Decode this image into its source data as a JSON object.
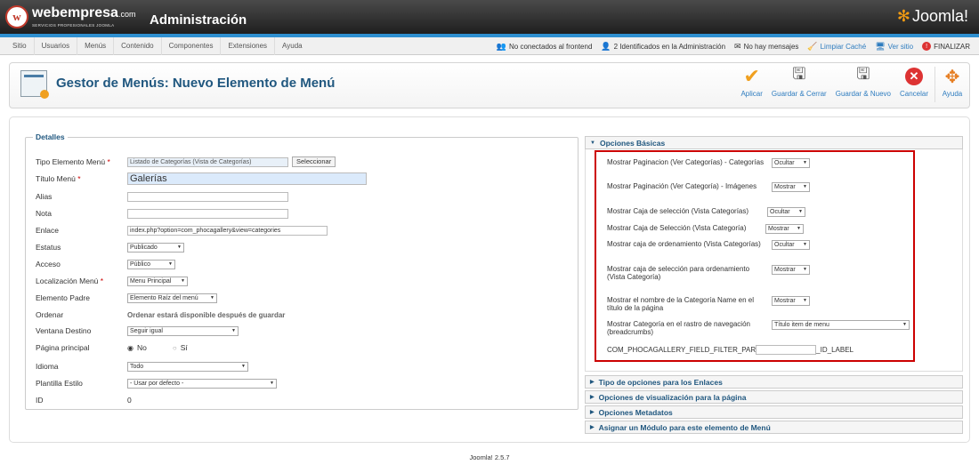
{
  "header": {
    "brand": "webempresa",
    "brand_suffix": ".com",
    "brand_tagline": "SERVICIOS PROFESIONALES JOOMLA",
    "title": "Administración",
    "joomla_logo": "Joomla!"
  },
  "nav": {
    "items": [
      "Sitio",
      "Usuarios",
      "Menús",
      "Contenido",
      "Componentes",
      "Extensiones",
      "Ayuda"
    ]
  },
  "status": {
    "frontend": "No conectados al frontend",
    "admins": "2 Identificados en la Administración",
    "messages": "No hay mensajes",
    "clear_cache": "Limpiar Caché",
    "view_site": "Ver sitio",
    "logout": "FINALIZAR"
  },
  "toolbar": {
    "page_title": "Gestor de Menús: Nuevo Elemento de Menú",
    "apply": "Aplicar",
    "save_close": "Guardar & Cerrar",
    "save_new": "Guardar & Nuevo",
    "cancel": "Cancelar",
    "help": "Ayuda"
  },
  "details": {
    "legend": "Detalles",
    "tipo_label": "Tipo Elemento Menú",
    "tipo_value": "Listado de  Categorías (Vista de Categorías)",
    "seleccionar": "Seleccionar",
    "titulo_label": "Título Menú",
    "titulo_value": "Galerías",
    "alias_label": "Alias",
    "nota_label": "Nota",
    "enlace_label": "Enlace",
    "enlace_value": "index.php?option=com_phocagallery&view=categories",
    "estatus_label": "Estatus",
    "estatus_value": "Publicado",
    "acceso_label": "Acceso",
    "acceso_value": "Público",
    "localizacion_label": "Localización Menú",
    "localizacion_value": "Menu Principal",
    "padre_label": "Elemento Padre",
    "padre_value": "Elemento Raíz del menú",
    "ordenar_label": "Ordenar",
    "ordenar_value": "Ordenar estará disponible después de guardar",
    "ventana_label": "Ventana Destino",
    "ventana_value": "Seguir igual",
    "principal_label": "Página principal",
    "no": "No",
    "si": "Sí",
    "idioma_label": "Idioma",
    "idioma_value": "Todo",
    "plantilla_label": "Plantilla Estilo",
    "plantilla_value": "- Usar por defecto -",
    "id_label": "ID",
    "id_value": "0",
    "required_mark": "*"
  },
  "options": {
    "basic_title": "Opciones Básicas",
    "items": [
      {
        "label": "Mostrar Paginacion (Ver Categorías) - Categorías",
        "value": "Ocultar"
      },
      {
        "label": "Mostrar Paginación (Ver Categoría) - Imágenes",
        "value": "Mostrar"
      },
      {
        "label": "Mostrar Caja de selección (Vista Categorías)",
        "value": "Ocultar"
      },
      {
        "label": "Mostrar Caja de Selección (Vista Categoría)",
        "value": "Mostrar"
      },
      {
        "label": "Mostrar caja de ordenamiento (Vista Categorías)",
        "value": "Ocultar"
      },
      {
        "label": "Mostrar caja de selección para ordenamiento (Vista Categoría)",
        "value": "Mostrar"
      },
      {
        "label": "Mostrar el nombre de la Categoría Name en el título de la página",
        "value": "Mostrar"
      },
      {
        "label": "Mostrar Categoría en el rastro de navegación (breadcrumbs)",
        "value": "Título item de menu"
      }
    ],
    "filter_prefix": "COM_PHOCAGALLERY_FIELD_FILTER_PAR",
    "filter_suffix": "_ID_LABEL",
    "panels": [
      "Tipo de opciones para los Enlaces",
      "Opciones de visualización para la página",
      "Opciones Metadatos",
      "Asignar un Módulo para este elemento de Menú"
    ]
  },
  "footer": "Joomla! 2.5.7"
}
